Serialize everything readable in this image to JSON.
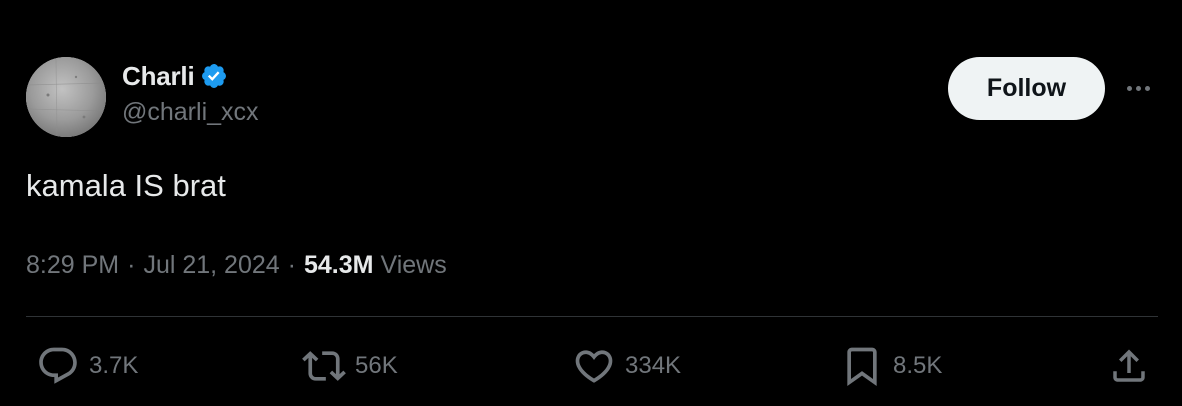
{
  "author": {
    "display_name": "Charli",
    "handle": "@charli_xcx",
    "verified": true,
    "verified_badge_color": "#1d9bf0",
    "avatar_icon": "avatar-photo"
  },
  "header": {
    "follow_label": "Follow",
    "more_icon": "more-horizontal-icon"
  },
  "tweet": {
    "text": "kamala IS brat",
    "time": "8:29 PM",
    "separator": "·",
    "date": "Jul 21, 2024",
    "views_count": "54.3M",
    "views_label": "Views"
  },
  "actions": {
    "reply": {
      "icon": "reply-icon",
      "count": "3.7K"
    },
    "repost": {
      "icon": "repost-icon",
      "count": "56K"
    },
    "like": {
      "icon": "heart-icon",
      "count": "334K"
    },
    "bookmark": {
      "icon": "bookmark-icon",
      "count": "8.5K"
    },
    "share": {
      "icon": "share-icon"
    }
  },
  "colors": {
    "background": "#000000",
    "primary_text": "#e7e9ea",
    "secondary_text": "#71767b",
    "divider": "#2f3336",
    "follow_button_bg": "#eff3f4",
    "follow_button_text": "#0f1419"
  }
}
